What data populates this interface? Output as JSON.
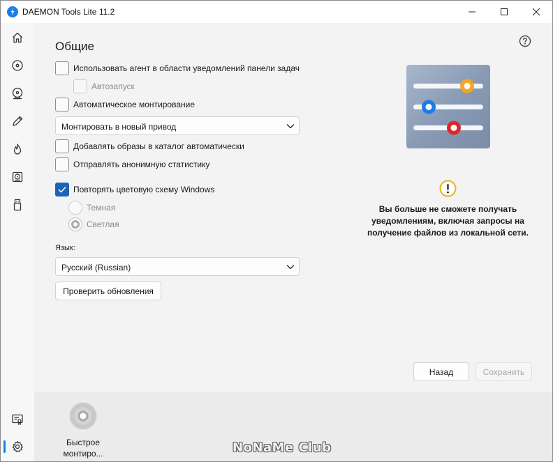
{
  "window": {
    "title": "DAEMON Tools Lite 11.2"
  },
  "sidebar": {
    "items": [
      {
        "icon": "home-icon"
      },
      {
        "icon": "disc-icon"
      },
      {
        "icon": "disc-image-icon"
      },
      {
        "icon": "pencil-icon"
      },
      {
        "icon": "flame-icon"
      },
      {
        "icon": "virtual-drive-icon"
      },
      {
        "icon": "usb-drive-icon"
      },
      {
        "icon": "license-icon"
      },
      {
        "icon": "gear-icon",
        "active": true
      }
    ]
  },
  "settings": {
    "title": "Общие",
    "use_agent_label": "Использовать агент в области уведомлений панели задач",
    "autostart_label": "Автозапуск",
    "auto_mount_label": "Автоматическое монтирование",
    "mount_dropdown_value": "Монтировать в новый привод",
    "add_images_label": "Добавлять образы в каталог автоматически",
    "send_stats_label": "Отправлять анонимную статистику",
    "repeat_color_label": "Повторять цветовую схему Windows",
    "theme_dark_label": "Темная",
    "theme_light_label": "Светлая",
    "language_label": "Язык:",
    "language_value": "Русский (Russian)",
    "check_updates_label": "Проверить обновления",
    "back_label": "Назад",
    "save_label": "Сохранить"
  },
  "warning": {
    "text": "Вы больше не сможете получать уведомлениям, включая запросы на получение файлов из локальной сети."
  },
  "bottom": {
    "quick_mount_label": "Быстрое монтиро...",
    "watermark": "NoNaMe Club"
  },
  "colors": {
    "accent": "#1b63b8",
    "slider_orange": "#f5a623",
    "slider_blue": "#1b7ee6",
    "slider_red": "#e0262d",
    "warning": "#e8b21a"
  }
}
